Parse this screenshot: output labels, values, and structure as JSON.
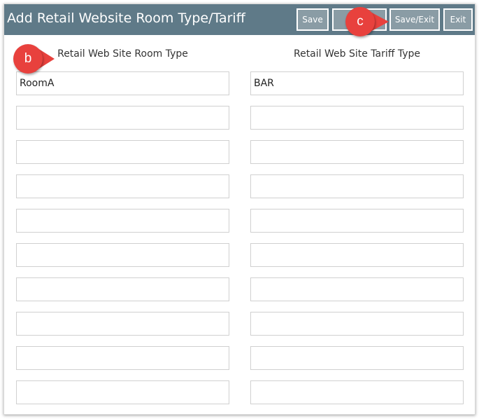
{
  "header": {
    "title": "Add Retail Website Room Type/Tariff",
    "buttons": {
      "save": "Save",
      "save_add": "",
      "save_exit": "Save/Exit",
      "exit": "Exit"
    },
    "background_color": "#5f7a88"
  },
  "columns": {
    "room_type_label": "Retail Web Site Room Type",
    "tariff_type_label": "Retail Web Site Tariff Type"
  },
  "rows": [
    {
      "room_type": "RoomA",
      "tariff_type": "BAR"
    },
    {
      "room_type": "",
      "tariff_type": ""
    },
    {
      "room_type": "",
      "tariff_type": ""
    },
    {
      "room_type": "",
      "tariff_type": ""
    },
    {
      "room_type": "",
      "tariff_type": ""
    },
    {
      "room_type": "",
      "tariff_type": ""
    },
    {
      "room_type": "",
      "tariff_type": ""
    },
    {
      "room_type": "",
      "tariff_type": ""
    },
    {
      "room_type": "",
      "tariff_type": ""
    },
    {
      "room_type": "",
      "tariff_type": ""
    }
  ],
  "callouts": {
    "b": "b",
    "c": "c",
    "color": "#e8413d"
  }
}
